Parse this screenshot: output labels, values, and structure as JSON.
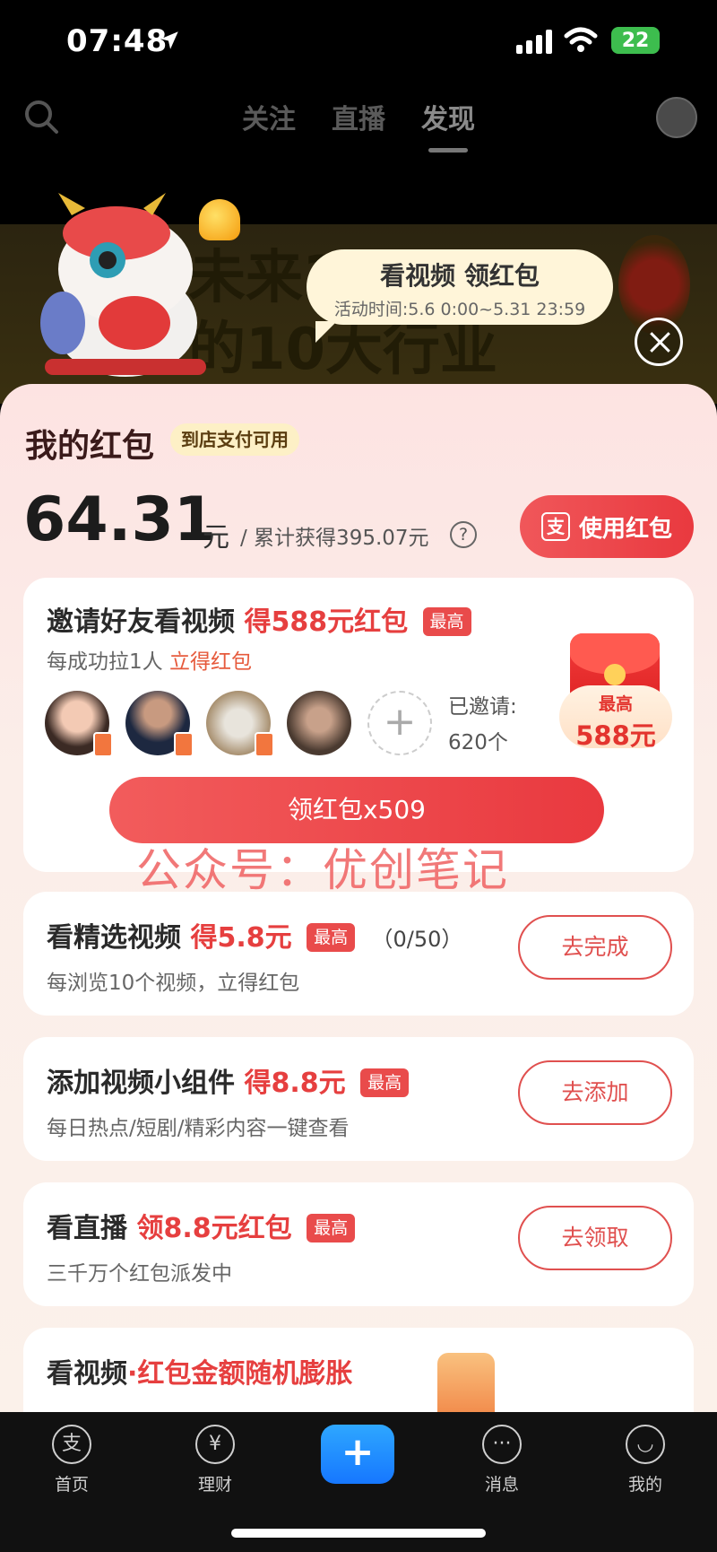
{
  "status_bar": {
    "time": "07:48",
    "battery": "22"
  },
  "top_nav": {
    "tabs": [
      "关注",
      "直播",
      "发现"
    ],
    "active_tab": "发现"
  },
  "banner": {
    "text_line1": "未来3",
    "text_line2": "的10大行业"
  },
  "bubble": {
    "title": "看视频 领红包",
    "subtitle": "活动时间:5.6 0:00~5.31 23:59"
  },
  "sheet": {
    "title": "我的红包",
    "pay_badge": "到店支付可用",
    "amount": "64.31",
    "unit": "元",
    "total": "/ 累计获得395.07元",
    "help": "?",
    "use_button": "使用红包",
    "use_button_icon": "支"
  },
  "invite": {
    "title": "邀请好友看视频",
    "title_highlight": "得588元红包",
    "tag": "最高",
    "subtitle": "每成功拉1人",
    "subtitle_highlight": "立得红包",
    "add_symbol": "+",
    "invited_label": "已邀请:",
    "invited_count": "620个",
    "envelope_label": "最高",
    "envelope_amount": "588元",
    "claim_button": "领红包x509"
  },
  "watermark": "公众号：优创笔记",
  "tasks": [
    {
      "title": "看精选视频",
      "reward": "得5.8元",
      "tag": "最高",
      "progress": "（0/50）",
      "subtitle": "每浏览10个视频，立得红包",
      "button": "去完成"
    },
    {
      "title": "添加视频小组件",
      "reward": "得8.8元",
      "tag": "最高",
      "subtitle": "每日热点/短剧/精彩内容一键查看",
      "button": "去添加"
    },
    {
      "title": "看直播",
      "reward": "领8.8元红包",
      "tag": "最高",
      "subtitle": "三千万个红包派发中",
      "button": "去领取"
    },
    {
      "title": "看视频",
      "reward": "·红包金额随机膨胀"
    }
  ],
  "tab_bar": {
    "items": [
      {
        "label": "首页",
        "icon": "支"
      },
      {
        "label": "理财",
        "icon": "¥"
      },
      {
        "label": "消息",
        "icon": "···"
      },
      {
        "label": "我的",
        "icon": "◡"
      }
    ],
    "plus": "+"
  },
  "colors": {
    "accent": "#e9393f",
    "alipay_blue": "#1677ff",
    "sheet_bg": "#fde3e2"
  }
}
